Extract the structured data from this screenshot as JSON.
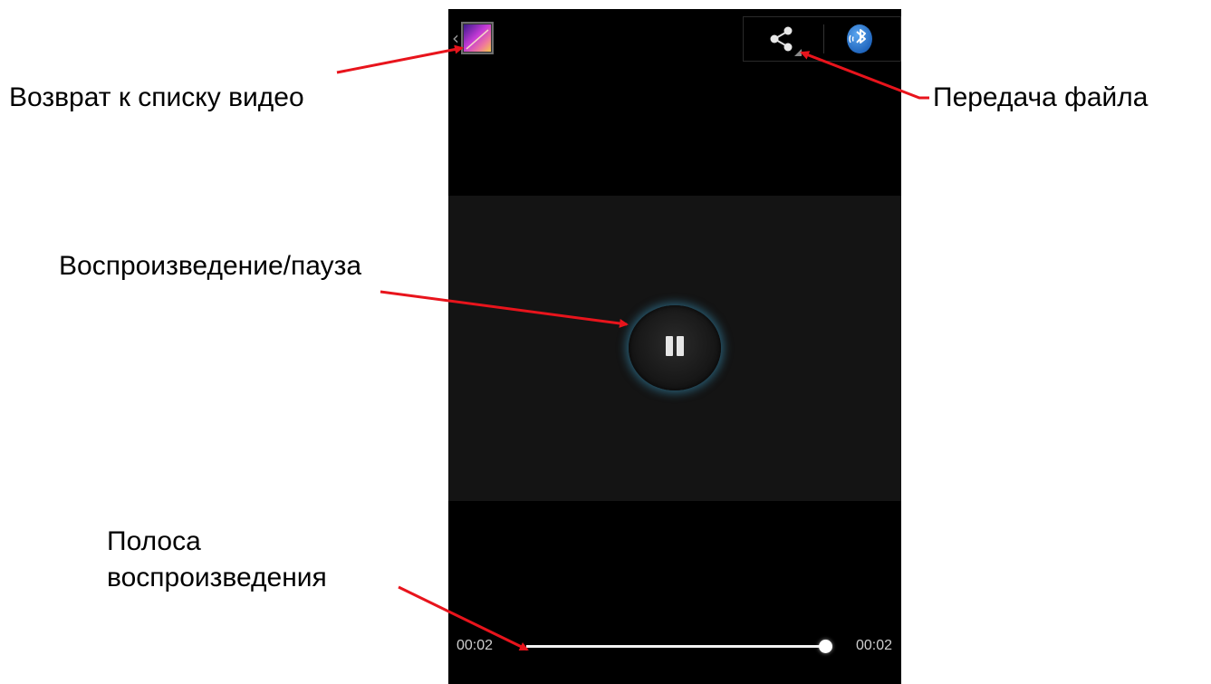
{
  "annotations": {
    "back": "Возврат к списку видео",
    "share": "Передача файла",
    "play_pause": "Воспроизведение/пауза",
    "progress_line1": "Полоса",
    "progress_line2": "воспроизведения"
  },
  "player": {
    "time_current": "00:02",
    "time_total": "00:02",
    "progress": 1.0,
    "state": "playing"
  },
  "icons": {
    "back": "chevron-left-icon",
    "gallery": "gallery-icon",
    "share": "share-icon",
    "bluetooth": "bluetooth-icon",
    "pause": "pause-icon"
  },
  "colors": {
    "annotation_arrow": "#e8141c",
    "play_glow": "#3896be",
    "bluetooth": "#1d6fd0"
  }
}
